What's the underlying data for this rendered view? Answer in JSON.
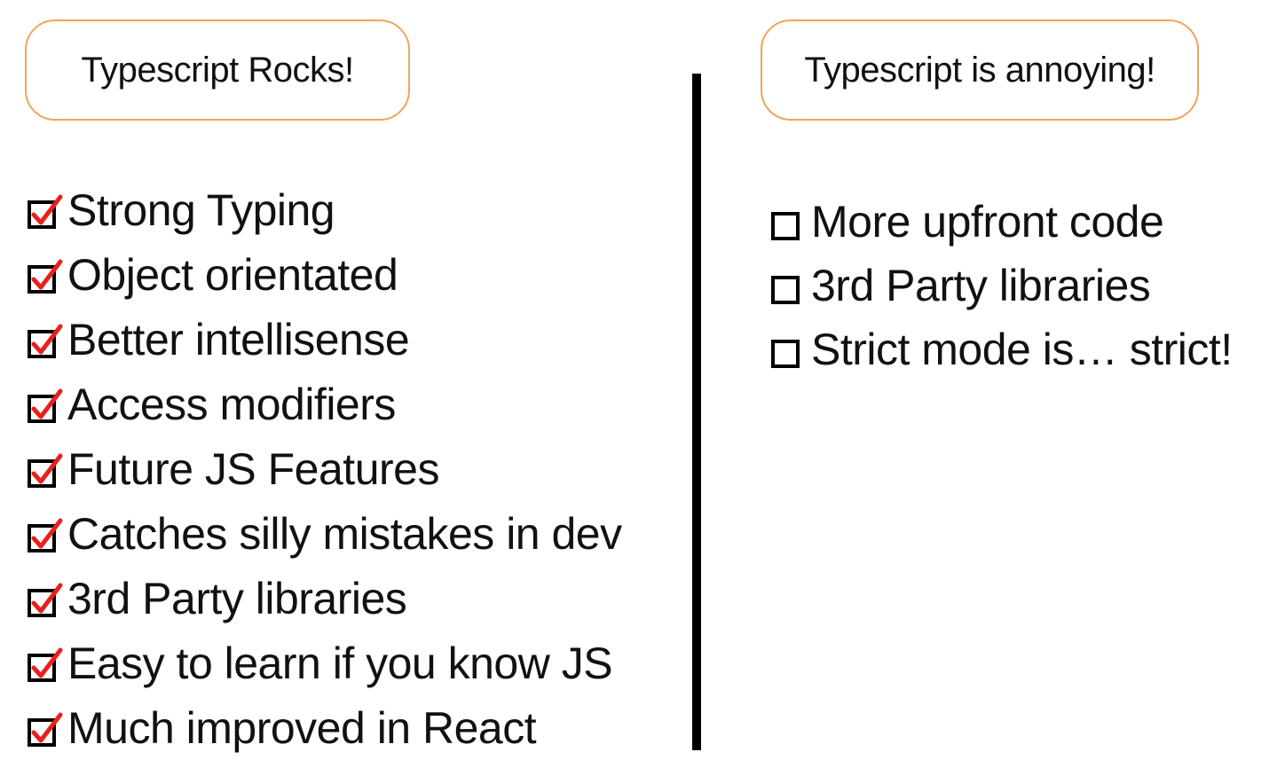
{
  "left": {
    "title": "Typescript Rocks!",
    "items": [
      {
        "label": "Strong Typing",
        "checked": true
      },
      {
        "label": "Object orientated",
        "checked": true
      },
      {
        "label": "Better intellisense",
        "checked": true
      },
      {
        "label": "Access modifiers",
        "checked": true
      },
      {
        "label": "Future JS Features",
        "checked": true
      },
      {
        "label": "Catches silly mistakes in dev",
        "checked": true
      },
      {
        "label": "3rd Party libraries",
        "checked": true
      },
      {
        "label": "Easy to learn if you know JS",
        "checked": true
      },
      {
        "label": "Much improved in React",
        "checked": true
      }
    ]
  },
  "right": {
    "title": "Typescript is annoying!",
    "items": [
      {
        "label": "More upfront code",
        "checked": false
      },
      {
        "label": "3rd Party libraries",
        "checked": false
      },
      {
        "label": "Strict mode is… strict!",
        "checked": false
      }
    ]
  },
  "colors": {
    "header_border": "#eea55a",
    "check": "#e8201c",
    "divider": "#000000"
  }
}
